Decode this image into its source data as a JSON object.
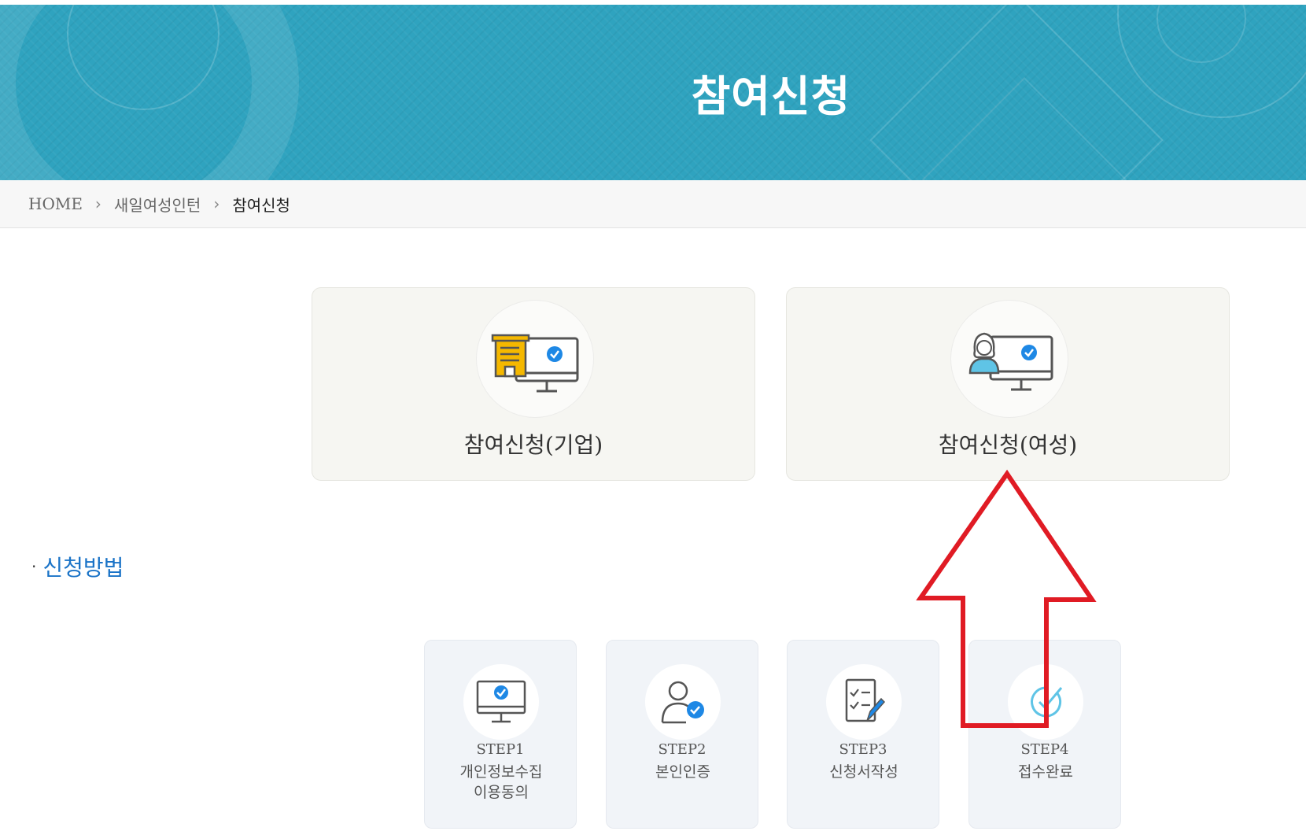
{
  "banner": {
    "title": "참여신청"
  },
  "breadcrumb": {
    "home": "HOME",
    "level1": "새일여성인턴",
    "current": "참여신청",
    "separator": "›"
  },
  "cards": [
    {
      "label": "참여신청(기업)",
      "icon": "company-computer-icon"
    },
    {
      "label": "참여신청(여성)",
      "icon": "woman-computer-icon"
    }
  ],
  "method": {
    "bullet": "·",
    "title": "신청방법"
  },
  "steps": [
    {
      "num": "STEP1",
      "desc_line1": "개인정보수집",
      "desc_line2": "이용동의",
      "icon": "monitor-check-icon"
    },
    {
      "num": "STEP2",
      "desc_line1": "본인인증",
      "desc_line2": "",
      "icon": "user-check-icon"
    },
    {
      "num": "STEP3",
      "desc_line1": "신청서작성",
      "desc_line2": "",
      "icon": "checklist-pen-icon"
    },
    {
      "num": "STEP4",
      "desc_line1": "접수완료",
      "desc_line2": "",
      "icon": "circle-check-icon"
    }
  ],
  "colors": {
    "banner": "#2fa3bf",
    "accent_blue": "#1a73c7",
    "check_blue": "#1e88e5",
    "building_yellow": "#f5b800",
    "annotation_red": "#e01b24"
  }
}
